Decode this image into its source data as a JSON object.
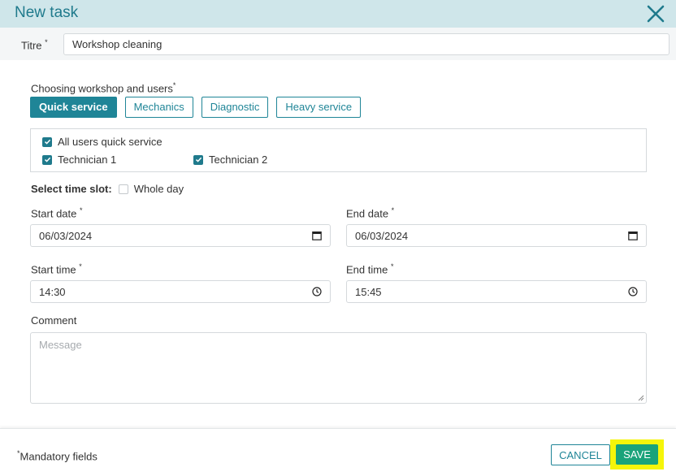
{
  "dialog": {
    "title": "New task"
  },
  "titre": {
    "label": "Titre",
    "value": "Workshop cleaning"
  },
  "workshop": {
    "label": "Choosing workshop and users",
    "chips": [
      {
        "label": "Quick service",
        "active": true
      },
      {
        "label": "Mechanics",
        "active": false
      },
      {
        "label": "Diagnostic",
        "active": false
      },
      {
        "label": "Heavy service",
        "active": false
      }
    ],
    "users": [
      {
        "label": "All users quick service",
        "checked": true
      },
      {
        "label": "Technician 1",
        "checked": true
      },
      {
        "label": "Technician 2",
        "checked": true
      }
    ]
  },
  "time_slot": {
    "label": "Select time slot:",
    "whole_day_label": "Whole day",
    "whole_day_checked": false
  },
  "start_date": {
    "label": "Start date",
    "value": "06/03/2024"
  },
  "end_date": {
    "label": "End date",
    "value": "06/03/2024"
  },
  "start_time": {
    "label": "Start time",
    "value": "14:30"
  },
  "end_time": {
    "label": "End time",
    "value": "15:45"
  },
  "comment": {
    "label": "Comment",
    "placeholder": "Message",
    "value": ""
  },
  "footer": {
    "mandatory_text": "Mandatory fields",
    "cancel_label": "CANCEL",
    "save_label": "SAVE"
  },
  "required_marker": "*",
  "colors": {
    "accent": "#1f8597",
    "header_bg": "#cfe6ea",
    "save": "#1aa37a",
    "highlight": "#f5f50a"
  },
  "icons": [
    "close-icon",
    "check-icon",
    "calendar-icon",
    "clock-icon",
    "resize-grip-icon"
  ]
}
